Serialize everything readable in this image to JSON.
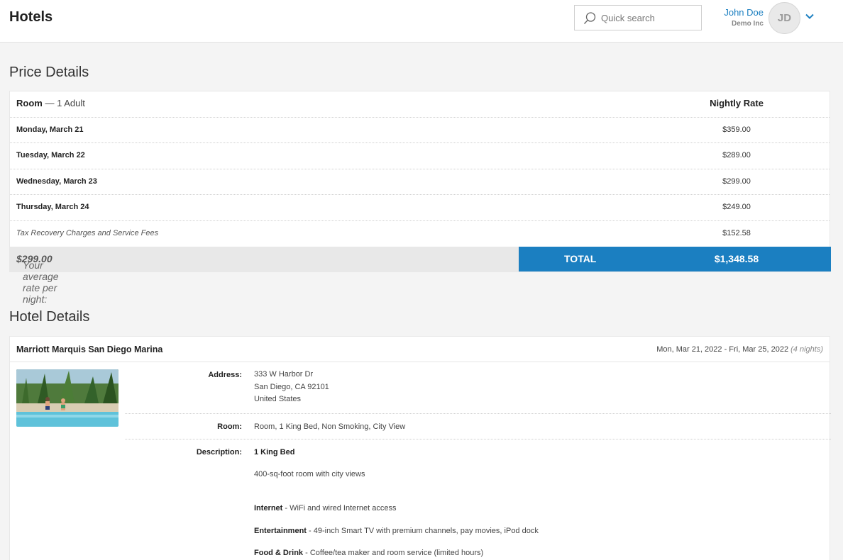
{
  "header": {
    "title": "Hotels",
    "search_placeholder": "Quick search",
    "user_name": "John Doe",
    "user_org": "Demo Inc",
    "avatar_initials": "JD",
    "accent_color": "#1b7fc1"
  },
  "price_details": {
    "title": "Price Details",
    "room_label": "Room",
    "room_sep": " — ",
    "room_occupancy": "1 Adult",
    "rate_header": "Nightly Rate",
    "rows": [
      {
        "label": "Monday, March 21",
        "value": "$359.00"
      },
      {
        "label": "Tuesday, March 22",
        "value": "$289.00"
      },
      {
        "label": "Wednesday, March 23",
        "value": "$299.00"
      },
      {
        "label": "Thursday, March 24",
        "value": "$249.00"
      }
    ],
    "fees_label": "Tax Recovery Charges and Service Fees",
    "fees_value": "$152.58",
    "avg_label": "Your average rate per night: ",
    "avg_value": "$299.00",
    "total_label": "TOTAL",
    "total_value": "$1,348.58"
  },
  "hotel_details": {
    "title": "Hotel Details",
    "name": "Marriott Marquis San Diego Marina",
    "dates": "Mon, Mar 21, 2022 - Fri, Mar 25, 2022",
    "nights": "(4 nights)",
    "address_label": "Address:",
    "address_line1": "333 W Harbor Dr",
    "address_line2": "San Diego, CA 92101",
    "address_line3": "United States",
    "room_label": "Room:",
    "room_value": "Room, 1 King Bed, Non Smoking, City View",
    "description_label": "Description:",
    "desc_bed": "1 King Bed",
    "desc_size": "400-sq-foot room with city views",
    "features": [
      {
        "name": "Internet",
        "text": " - WiFi and wired Internet access"
      },
      {
        "name": "Entertainment",
        "text": " - 49-inch Smart TV with premium channels, pay movies, iPod dock"
      },
      {
        "name": "Food & Drink",
        "text": " - Coffee/tea maker and room service (limited hours)"
      }
    ]
  }
}
